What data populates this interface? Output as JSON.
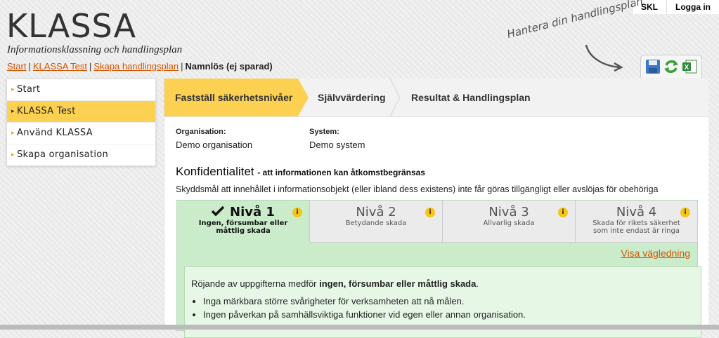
{
  "header": {
    "logo": "KLASSA",
    "tagline": "Informationsklassning och handlingsplan",
    "breadcrumb": [
      {
        "label": "Start"
      },
      {
        "label": "KLASSA Test"
      },
      {
        "label": "Skapa handlingsplan"
      }
    ],
    "breadcrumb_current": "Namnlös (ej sparad)",
    "separator": "|",
    "top_links": {
      "skl": "SKL",
      "login": "Logga in"
    },
    "hint": "Hantera din handlingsplan",
    "toolbar_icons": [
      "save-icon",
      "refresh-icon",
      "excel-icon"
    ]
  },
  "sidebar": {
    "items": [
      {
        "label": "Start",
        "active": false
      },
      {
        "label": "KLASSA Test",
        "active": true
      },
      {
        "label": "Använd KLASSA",
        "active": false
      },
      {
        "label": "Skapa organisation",
        "active": false
      }
    ]
  },
  "steps": [
    {
      "label": "Fastställ säkerhetsnivåer",
      "active": true
    },
    {
      "label": "Självvärdering",
      "active": false
    },
    {
      "label": "Resultat & Handlingsplan",
      "active": false
    }
  ],
  "info": {
    "org_label": "Organisation:",
    "org_value": "Demo organisation",
    "system_label": "System:",
    "system_value": "Demo system"
  },
  "section": {
    "title": "Konfidentialitet",
    "subtitle": "- att informationen kan åtkomstbegränsas",
    "description": "Skyddsmål att innehållet i informationsobjekt (eller ibland dess existens) inte får göras tillgängligt eller avslöjas för obehöriga"
  },
  "levels": [
    {
      "name": "Nivå 1",
      "desc": "Ingen, försumbar eller måttlig skada",
      "selected": true
    },
    {
      "name": "Nivå 2",
      "desc": "Betydande skada",
      "selected": false
    },
    {
      "name": "Nivå 3",
      "desc": "Allvarlig skada",
      "selected": false
    },
    {
      "name": "Nivå 4",
      "desc": "Skada för rikets säkerhet som inte endast är ringa",
      "selected": false
    }
  ],
  "info_badge": "i",
  "guide_link": "Visa vägledning",
  "detail": {
    "intro_prefix": "Röjande av uppgifterna medför ",
    "intro_bold": "ingen, försumbar eller måttlig skada",
    "intro_suffix": ".",
    "bullets": [
      "Inga märkbara större svårigheter för verksamheten att nå målen.",
      "Ingen påverkan på samhällsviktiga funktioner vid egen eller annan organisation."
    ]
  },
  "colors": {
    "accent": "#fcd152",
    "link": "#d35400",
    "selected_level": "#cbeccb"
  }
}
